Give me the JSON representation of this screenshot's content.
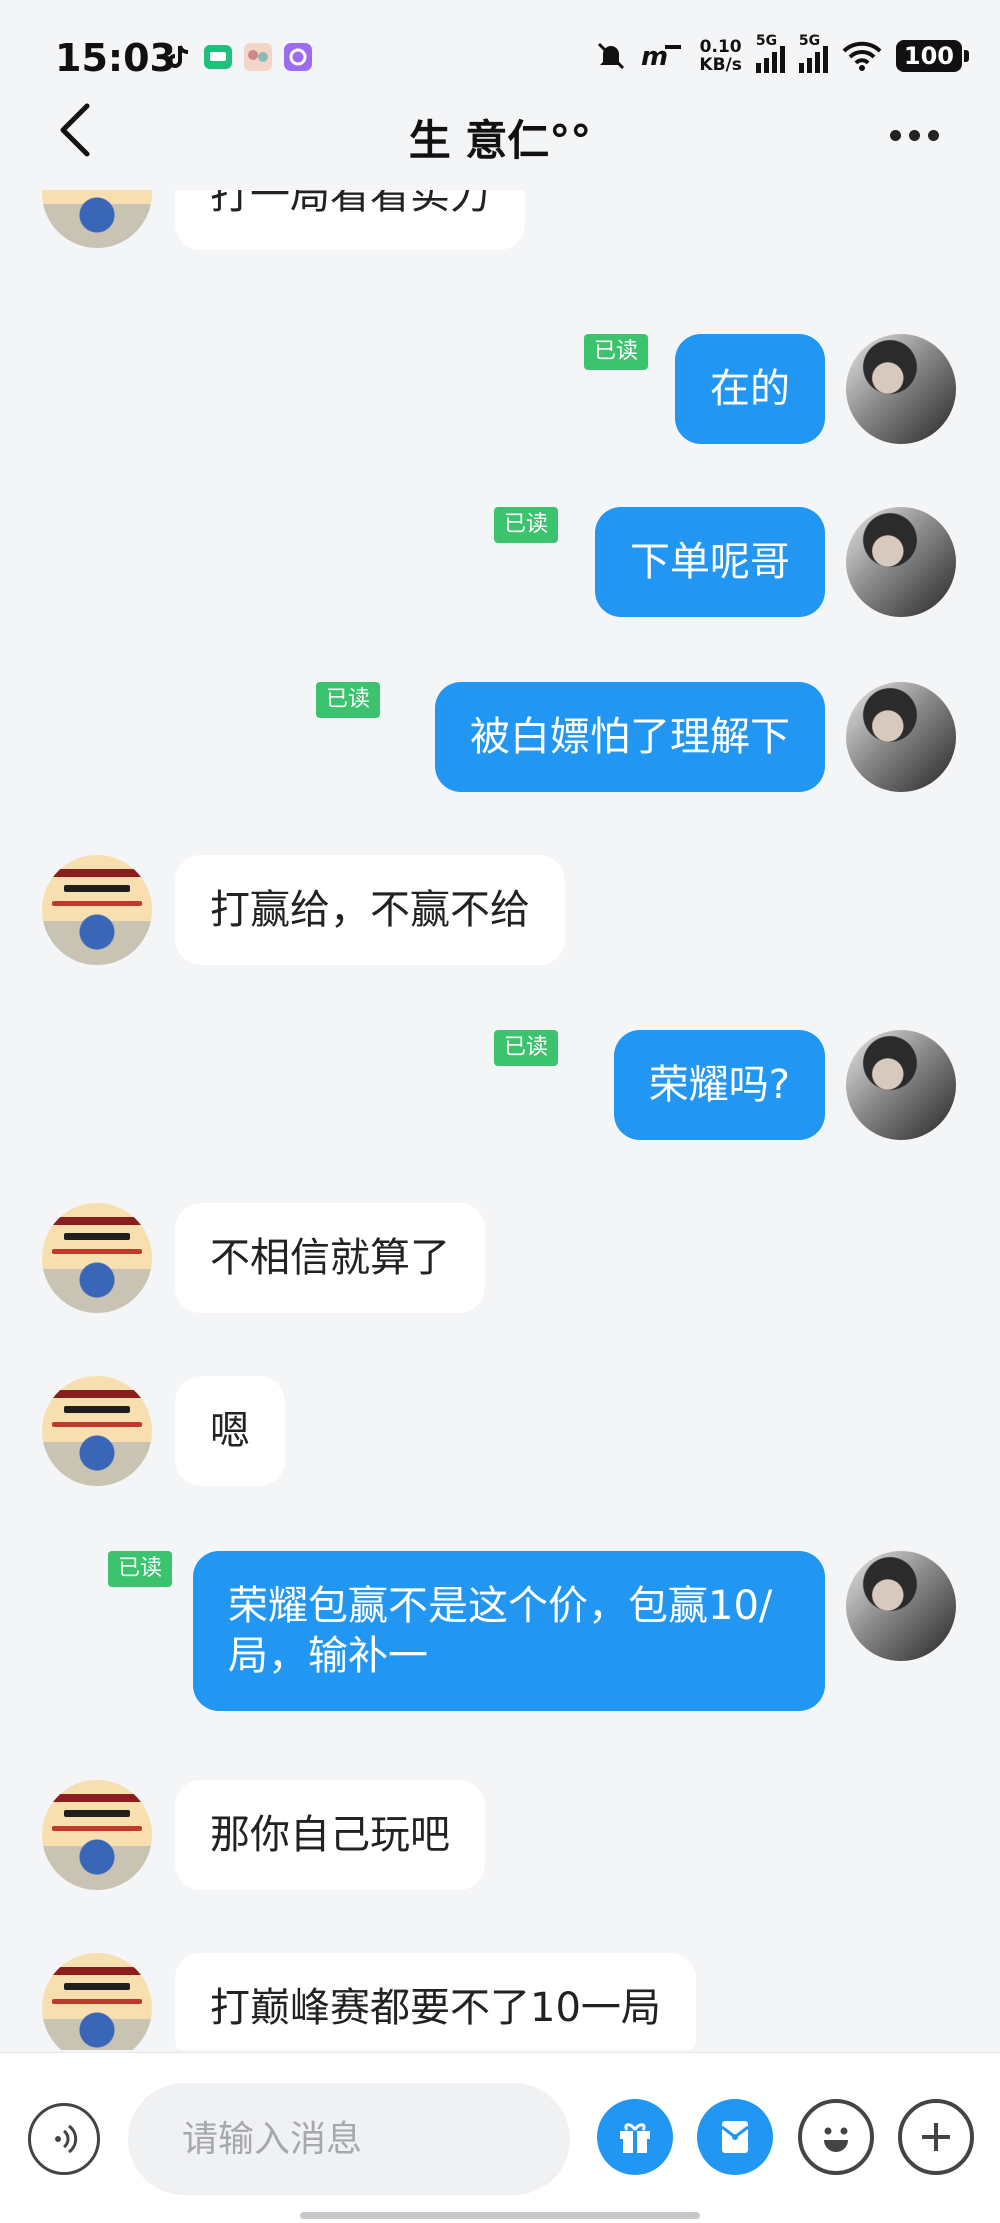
{
  "status_bar": {
    "time": "15:03",
    "net_speed_value": "0.10",
    "net_speed_unit": "KB/s",
    "sim1_label": "5G",
    "sim2_label": "5G",
    "battery": "100"
  },
  "header": {
    "title": "生 意仁°°"
  },
  "messages": [
    {
      "from": "other",
      "text": "打一局看看实力"
    },
    {
      "from": "me",
      "text": "在的",
      "read": "已读"
    },
    {
      "from": "me",
      "text": "下单呢哥",
      "read": "已读"
    },
    {
      "from": "me",
      "text": "被白嫖怕了理解下",
      "read": "已读"
    },
    {
      "from": "other",
      "text": "打赢给，不赢不给"
    },
    {
      "from": "me",
      "text": "荣耀吗?",
      "read": "已读"
    },
    {
      "from": "other",
      "text": "不相信就算了"
    },
    {
      "from": "other",
      "text": "嗯"
    },
    {
      "from": "me",
      "text": "荣耀包赢不是这个价，包赢10/局，输补一",
      "read": "已读"
    },
    {
      "from": "other",
      "text": "那你自己玩吧"
    },
    {
      "from": "other",
      "text": "打巅峰赛都要不了10一局"
    }
  ],
  "input": {
    "placeholder": "请输入消息",
    "value": ""
  },
  "icons": {
    "back": "chevron-left-icon",
    "more": "more-dots-icon",
    "voice": "voice-icon",
    "gift": "gift-icon",
    "red_packet": "red-packet-icon",
    "emoji": "emoji-icon",
    "plus": "plus-icon"
  },
  "colors": {
    "accent": "#2196f3",
    "read_badge": "#3cc36e",
    "background": "#f4f5f7"
  }
}
